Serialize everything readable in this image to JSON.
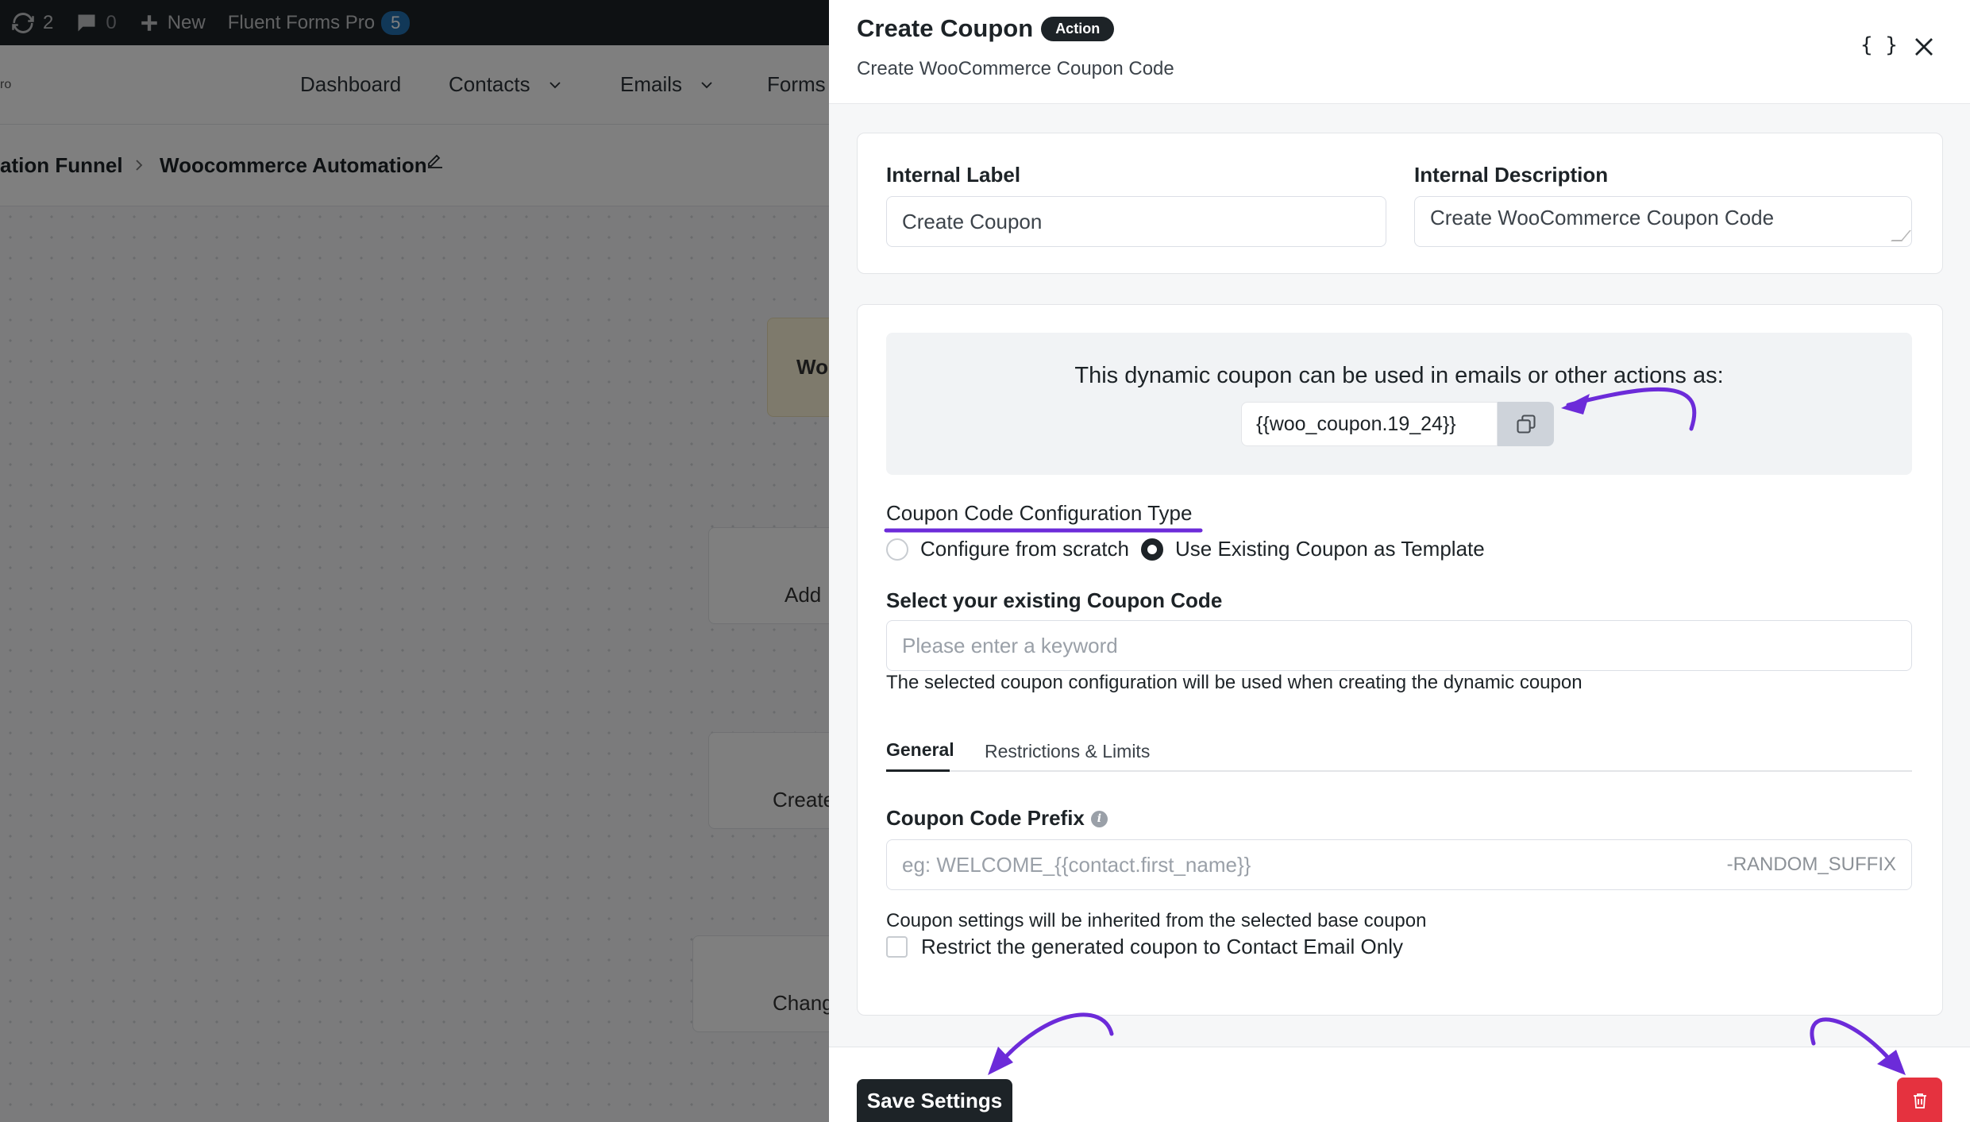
{
  "wp_admin_bar": {
    "updates_count": "2",
    "comments_count": "0",
    "new_label": "New",
    "plugin_label": "Fluent Forms Pro",
    "plugin_badge": "5"
  },
  "app_nav": {
    "brand_fragment": "ro",
    "items": [
      {
        "label": "Dashboard"
      },
      {
        "label": "Contacts"
      },
      {
        "label": "Emails"
      },
      {
        "label": "Forms"
      }
    ]
  },
  "breadcrumb": {
    "parent": "ation Funnel",
    "current": "Woocommerce Automation"
  },
  "canvas_nodes": [
    "Wo",
    "Add",
    "Create",
    "Chang"
  ],
  "drawer": {
    "title": "Create Coupon",
    "badge": "Action",
    "subtitle": "Create WooCommerce Coupon Code",
    "code_toggle": "{ }"
  },
  "meta": {
    "internal_label": {
      "label": "Internal Label",
      "value": "Create Coupon"
    },
    "internal_description": {
      "label": "Internal Description",
      "value": "Create WooCommerce Coupon Code"
    }
  },
  "coupon": {
    "dynamic_info": "This dynamic coupon can be used in emails or other actions as:",
    "smartcode": "{{woo_coupon.19_24}}",
    "config_type_label": "Coupon Code Configuration Type",
    "config_options": [
      {
        "label": "Configure from scratch",
        "selected": false
      },
      {
        "label": "Use Existing Coupon as Template",
        "selected": true
      }
    ],
    "existing_label": "Select your existing Coupon Code",
    "existing_placeholder": "Please enter a keyword",
    "existing_help": "The selected coupon configuration will be used when creating the dynamic coupon",
    "tabs": [
      {
        "label": "General",
        "active": true
      },
      {
        "label": "Restrictions & Limits",
        "active": false
      }
    ],
    "prefix_label": "Coupon Code Prefix",
    "prefix_placeholder": "eg: WELCOME_{{contact.first_name}}",
    "prefix_suffix": "-RANDOM_SUFFIX",
    "inherit_note": "Coupon settings will be inherited from the selected base coupon",
    "restrict_label": "Restrict the generated coupon to Contact Email Only",
    "restrict_checked": false
  },
  "footer": {
    "save_label": "Save Settings"
  },
  "colors": {
    "dark": "#1d2327",
    "annotation": "#6c2bd9",
    "danger": "#e5323f"
  }
}
